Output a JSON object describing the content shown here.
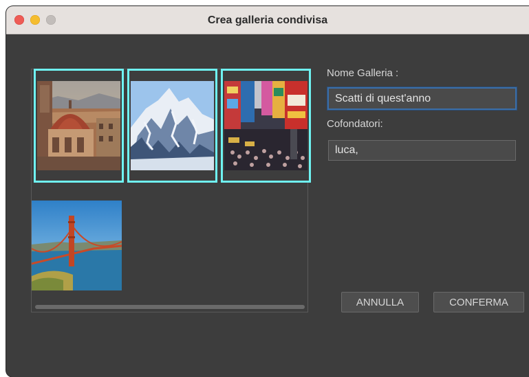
{
  "window": {
    "title": "Crea galleria condivisa"
  },
  "gallery": {
    "images": [
      {
        "name": "florence-cathedral",
        "selected": true
      },
      {
        "name": "snowy-mountains",
        "selected": true
      },
      {
        "name": "times-square",
        "selected": true
      },
      {
        "name": "golden-gate-bridge",
        "selected": false
      }
    ]
  },
  "form": {
    "name_label": "Nome Galleria :",
    "name_value": "Scatti di quest'anno",
    "cofounders_label": "Cofondatori:",
    "cofounders_value": "luca,"
  },
  "buttons": {
    "cancel": "ANNULLA",
    "confirm": "CONFERMA"
  },
  "colors": {
    "selection_border": "#6ff3f2",
    "background": "#3d3d3d",
    "focus_ring": "#3b6ea8"
  }
}
